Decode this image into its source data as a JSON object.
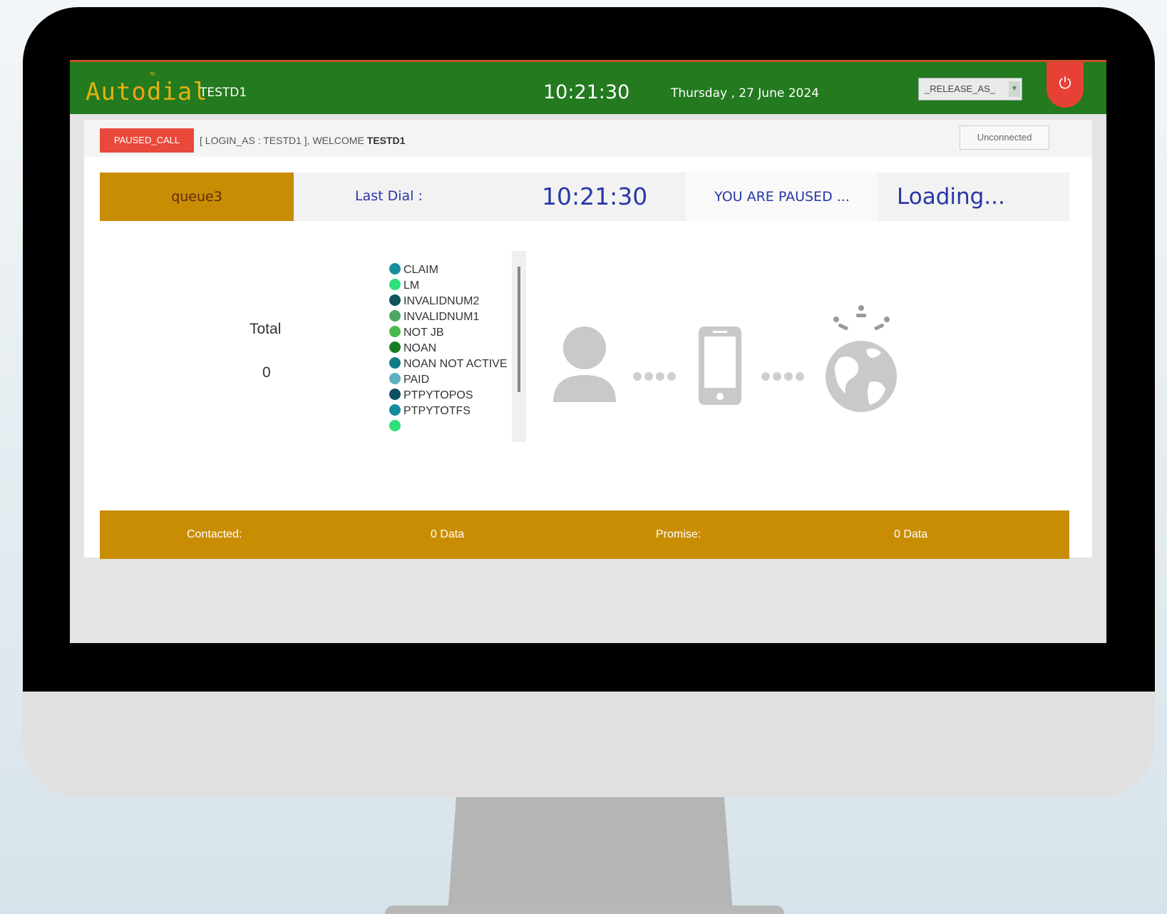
{
  "topbar": {
    "logo_prefix": "Aut",
    "logo_o": "o",
    "logo_suffix": "dial",
    "user_tag": "TESTD1",
    "clock": "10:21:30",
    "date": "Thursday , 27 June 2024",
    "release_select_value": "_RELEASE_AS_",
    "power_icon": "power-icon"
  },
  "status": {
    "badge": "PAUSED_CALL",
    "welcome_prefix": "[ LOGIN_AS : TESTD1 ], WELCOME ",
    "welcome_user": "TESTD1",
    "connection": "Unconnected"
  },
  "info": {
    "queue": "queue3",
    "last_dial_label": "Last Dial :",
    "dial_clock": "10:21:30",
    "paused_text": "YOU ARE PAUSED ...",
    "loading_text": "Loading..."
  },
  "stats": {
    "total_label": "Total",
    "total_value": "0"
  },
  "legend": [
    {
      "label": "CLAIM",
      "color": "#1b8c9c"
    },
    {
      "label": "LM",
      "color": "#2ee07a"
    },
    {
      "label": "INVALIDNUM2",
      "color": "#0f5257"
    },
    {
      "label": "INVALIDNUM1",
      "color": "#4ca860"
    },
    {
      "label": "NOT JB",
      "color": "#4cb84c"
    },
    {
      "label": "NOAN",
      "color": "#167d22"
    },
    {
      "label": "NOAN NOT ACTIVE",
      "color": "#107c86"
    },
    {
      "label": "PAID",
      "color": "#5cb0c0"
    },
    {
      "label": "PTPYTOPOS",
      "color": "#0d5066"
    },
    {
      "label": "PTPYTOTFS",
      "color": "#128c9e"
    },
    {
      "label": "",
      "color": "#2ee07a"
    }
  ],
  "footer": {
    "contacted_label": "Contacted:",
    "contacted_value": "0 Data",
    "promise_label": "Promise:",
    "promise_value": "0 Data"
  },
  "colors": {
    "topbar": "#237a1f",
    "accent_gold": "#c98d03",
    "paused_red": "#e8493b",
    "text_blue": "#2737a6"
  }
}
